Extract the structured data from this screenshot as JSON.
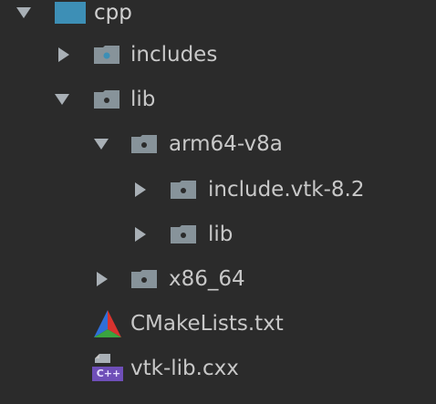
{
  "tree": {
    "items": [
      {
        "label": "cpp",
        "icon": "module-folder-icon",
        "expanded": true
      },
      {
        "label": "includes",
        "icon": "folder-icon",
        "expanded": false
      },
      {
        "label": "lib",
        "icon": "folder-icon",
        "expanded": true
      },
      {
        "label": "arm64-v8a",
        "icon": "folder-icon",
        "expanded": true
      },
      {
        "label": "include.vtk-8.2",
        "icon": "folder-icon",
        "expanded": false
      },
      {
        "label": "lib",
        "icon": "folder-icon",
        "expanded": false
      },
      {
        "label": "x86_64",
        "icon": "folder-icon",
        "expanded": false
      },
      {
        "label": "CMakeLists.txt",
        "icon": "cmake-icon"
      },
      {
        "label": "vtk-lib.cxx",
        "icon": "cpp-file-icon",
        "badge": "C++"
      }
    ]
  },
  "colors": {
    "background": "#2b2b2b",
    "text": "#c8c8c8",
    "arrow": "#a9b0b6",
    "folder": "#87939a",
    "folder_dot": "#2b2b2b",
    "module_folder": "#3d8fb6",
    "cpp_badge": "#6f4fb8"
  }
}
